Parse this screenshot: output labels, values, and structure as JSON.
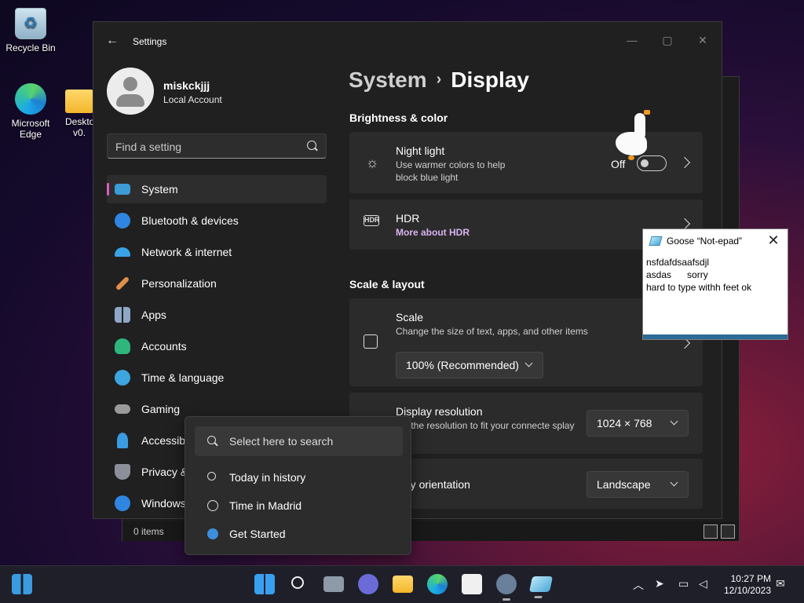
{
  "desktop": {
    "icons": [
      {
        "label": "Recycle Bin"
      },
      {
        "label": "Microsoft Edge"
      },
      {
        "label": "Deskto v0."
      }
    ]
  },
  "explorer": {
    "status_items": "0 items",
    "separator": "|"
  },
  "settings": {
    "window_title": "Settings",
    "user": {
      "name": "miskckjjj",
      "account_type": "Local Account"
    },
    "search_placeholder": "Find a setting",
    "nav": [
      {
        "label": "System",
        "icon": "system-icon",
        "color": "#3d9bd8",
        "active": true
      },
      {
        "label": "Bluetooth & devices",
        "icon": "bluetooth-icon",
        "color": "#2f86e0"
      },
      {
        "label": "Network & internet",
        "icon": "wifi-icon",
        "color": "#3aa3e8"
      },
      {
        "label": "Personalization",
        "icon": "brush-icon",
        "color": "#e0904a"
      },
      {
        "label": "Apps",
        "icon": "apps-icon",
        "color": "#8ea7c7"
      },
      {
        "label": "Accounts",
        "icon": "accounts-icon",
        "color": "#2fb67c"
      },
      {
        "label": "Time & language",
        "icon": "globe-clock-icon",
        "color": "#3da5e0"
      },
      {
        "label": "Gaming",
        "icon": "controller-icon",
        "color": "#9a9a9a"
      },
      {
        "label": "Accessibili",
        "icon": "accessibility-icon",
        "color": "#3a9be0"
      },
      {
        "label": "Privacy &",
        "icon": "shield-icon",
        "color": "#8a8f99"
      },
      {
        "label": "Windows",
        "icon": "update-icon",
        "color": "#2f86e0"
      }
    ],
    "breadcrumb": {
      "parent": "System",
      "separator": "›",
      "current": "Display"
    },
    "sections": {
      "brightness": "Brightness & color",
      "scale_layout": "Scale & layout"
    },
    "night_light": {
      "title": "Night light",
      "desc": "Use warmer colors to help block blue light",
      "toggle_label": "Off"
    },
    "hdr": {
      "title": "HDR",
      "link": "More about HDR"
    },
    "scale": {
      "title": "Scale",
      "desc": "Change the size of text, apps, and other items",
      "value": "100% (Recommended)"
    },
    "resolution": {
      "title": "Display resolution",
      "desc": "ust the resolution to fit your connecte splay",
      "value": "1024 × 768"
    },
    "orientation": {
      "title": "play orientation",
      "value": "Landscape"
    }
  },
  "notepad": {
    "title": "Goose “Not-epad”",
    "lines": "nsfdafdsaafsdjl\nasdas      sorry\nhard to type withh feet ok"
  },
  "search_popup": {
    "placeholder": "Select here to search",
    "items": [
      {
        "label": "Today in history",
        "icon": "search-icon"
      },
      {
        "label": "Time in Madrid",
        "icon": "clock-icon"
      },
      {
        "label": "Get Started",
        "icon": "get-started-icon"
      }
    ]
  },
  "taskbar": {
    "time": "10:27 PM",
    "date": "12/10/2023"
  }
}
